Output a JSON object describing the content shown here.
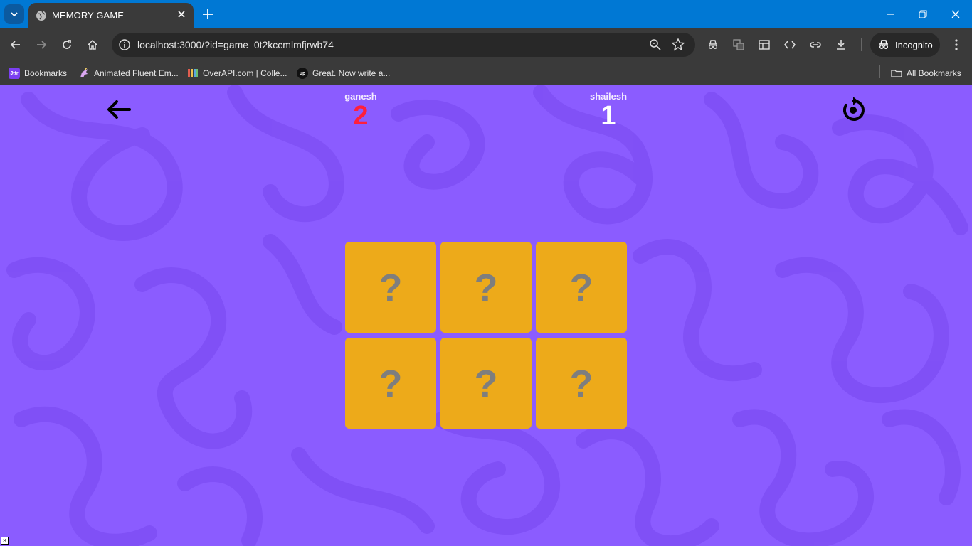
{
  "browser": {
    "tab_title": "MEMORY GAME",
    "url": "localhost:3000/?id=game_0t2kccmlmfjrwb74",
    "incognito_label": "Incognito",
    "bookmarks": [
      {
        "label": "Bookmarks",
        "icon": "jitter-icon",
        "color": "#7b3ff2"
      },
      {
        "label": "Animated Fluent Em...",
        "icon": "unicorn-icon",
        "color": "#c08ad9"
      },
      {
        "label": "OverAPI.com | Colle...",
        "icon": "overapi-icon",
        "color": "#d9534f"
      },
      {
        "label": "Great. Now write a...",
        "icon": "upwork-icon",
        "color": "#111111"
      }
    ],
    "all_bookmarks_label": "All Bookmarks"
  },
  "game": {
    "players": [
      {
        "name": "ganesh",
        "score": "2",
        "score_color": "#ff1f3c"
      },
      {
        "name": "shailesh",
        "score": "1",
        "score_color": "#ffffff"
      }
    ],
    "cards": [
      {
        "face": "?"
      },
      {
        "face": "?"
      },
      {
        "face": "?"
      },
      {
        "face": "?"
      },
      {
        "face": "?"
      },
      {
        "face": "?"
      }
    ],
    "colors": {
      "background": "#8b5cff",
      "card": "#edaa1a",
      "card_mark": "#7e7e7e"
    }
  }
}
